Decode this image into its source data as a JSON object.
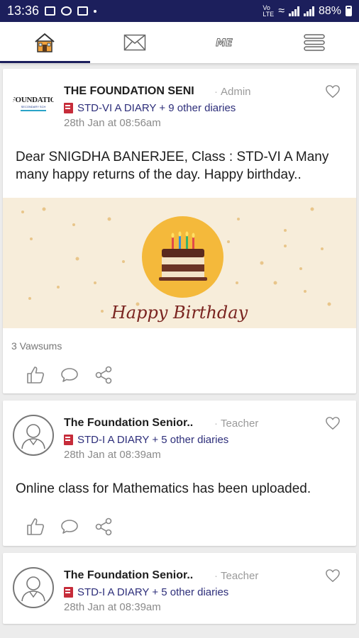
{
  "status": {
    "time": "13:36",
    "battery": "88%"
  },
  "tabs": [
    {
      "name": "home",
      "active": true
    },
    {
      "name": "messages",
      "active": false
    },
    {
      "name": "me",
      "label": "ME",
      "active": false
    },
    {
      "name": "menu",
      "active": false
    }
  ],
  "posts": [
    {
      "author": "THE FOUNDATION SENI",
      "role": "Admin",
      "avatar": {
        "type": "logo",
        "text": "FOUNDATIO",
        "subtext": "SECONDARY SCH"
      },
      "diaries": "STD-VI A DIARY + 9 other diaries",
      "time": "28th Jan at 08:56am",
      "message": "Dear SNIGDHA BANERJEE, Class : STD-VI A Many many happy returns of the day. Happy birthday..",
      "image_text": "Happy Birthday",
      "vawsums": "3 Vawsums"
    },
    {
      "author": "The Foundation Senior..",
      "role": "Teacher",
      "avatar": {
        "type": "person"
      },
      "diaries": "STD-I A DIARY + 5 other diaries",
      "time": "28th Jan at 08:39am",
      "message": "Online class for Mathematics has been uploaded."
    },
    {
      "author": "The Foundation Senior..",
      "role": "Teacher",
      "avatar": {
        "type": "person"
      },
      "diaries": "STD-I A DIARY + 5 other diaries",
      "time": "28th Jan at 08:39am"
    }
  ],
  "colors": {
    "statusbar": "#1c1f5c",
    "diary_text": "#2d2e7a",
    "accent": "#1c1f5c"
  }
}
